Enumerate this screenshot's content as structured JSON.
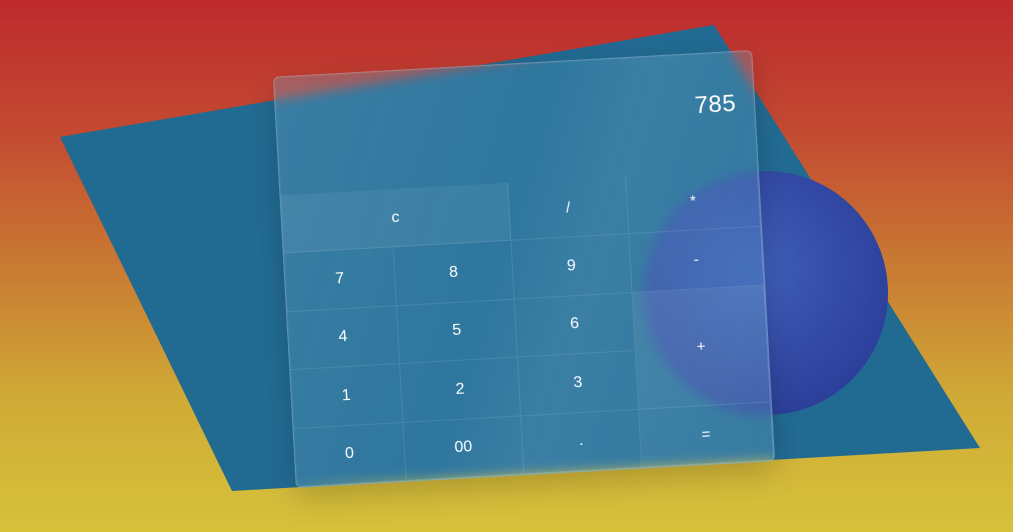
{
  "colors": {
    "background_top": "#be2a2e",
    "background_bottom": "#d5c23a",
    "shape_blue": "#216a92",
    "orb_blue": "#2f4ea6"
  },
  "display": {
    "value": "785"
  },
  "keys": {
    "clear": "c",
    "divide": "/",
    "multiply": "*",
    "seven": "7",
    "eight": "8",
    "nine": "9",
    "minus": "-",
    "four": "4",
    "five": "5",
    "six": "6",
    "plus": "+",
    "one": "1",
    "two": "2",
    "three": "3",
    "zero": "0",
    "double_zero": "00",
    "dot": ".",
    "equals": "="
  }
}
